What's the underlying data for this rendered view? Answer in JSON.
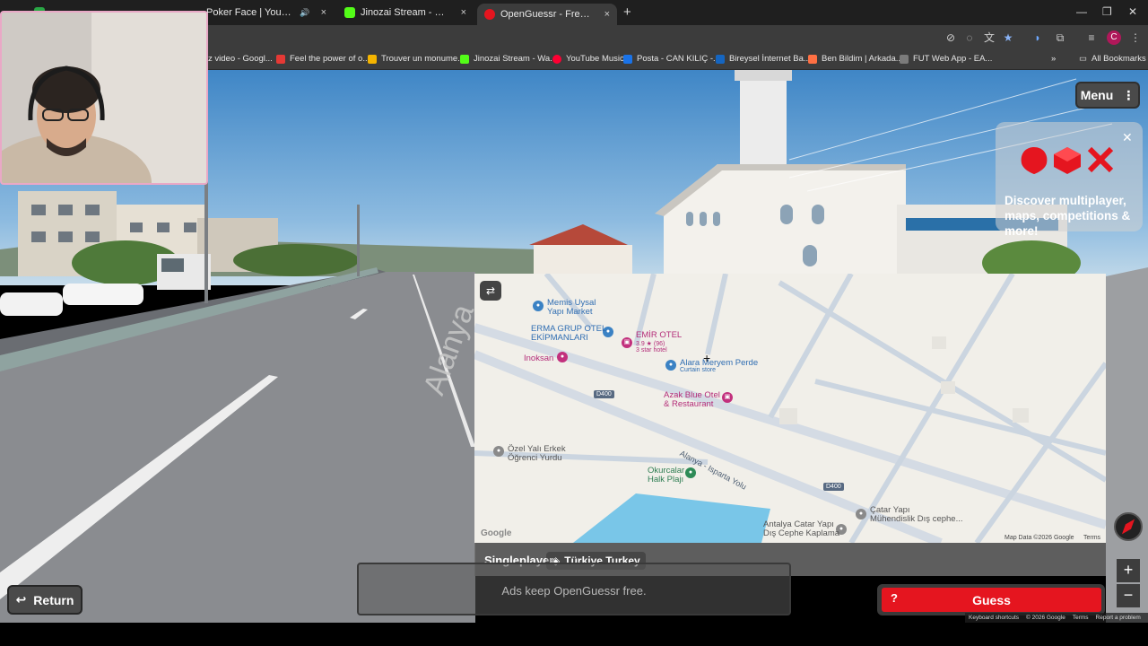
{
  "browser": {
    "tabs": [
      {
        "label": "",
        "favicon_color": "#29a745",
        "active": false
      },
      {
        "label": "Poker Face | YouTube Music",
        "favicon_color": "#ff0033",
        "active": false,
        "audio": "🔊"
      },
      {
        "label": "Jinozai Stream - Kick Dashboard",
        "favicon_color": "#53fc18",
        "active": false
      },
      {
        "label": "OpenGuessr - Free GeoGuessr A",
        "favicon_color": "#e5151f",
        "active": true
      }
    ],
    "new_tab": "+",
    "close": "×",
    "bookmarks": [
      {
        "label": "z video - Googl...",
        "favicon_color": "#4285f4"
      },
      {
        "label": "Feel the power of o...",
        "favicon_color": "#e53935"
      },
      {
        "label": "Trouver un monume...",
        "favicon_color": "#f4b400"
      },
      {
        "label": "Jinozai Stream - Wa...",
        "favicon_color": "#53fc18"
      },
      {
        "label": "YouTube Music",
        "favicon_color": "#ff0033"
      },
      {
        "label": "Posta - CAN KILIÇ -...",
        "favicon_color": "#1a73e8"
      },
      {
        "label": "Bireysel İnternet Ba...",
        "favicon_color": "#1565c0"
      },
      {
        "label": "Ben Bildim | Arkada...",
        "favicon_color": "#ff7043"
      },
      {
        "label": "FUT Web App - EA...",
        "favicon_color": "#7b7b7b"
      }
    ],
    "more_bookmarks": "»",
    "all_bookmarks": "All Bookmarks",
    "profile_initial": "C"
  },
  "game": {
    "menu_label": "Menu",
    "promo_text": "Discover multiplayer, maps, competitions & more!",
    "mode": "Singleplayer",
    "country": "Türkiye Turkey",
    "ad_text": "Ads keep OpenGuessr free.",
    "return_label": "Return",
    "guess_label": "Guess",
    "guess_help": "?",
    "zoom_in": "+",
    "zoom_out": "−"
  },
  "map": {
    "places": [
      {
        "name": "Memis Uysal",
        "sub": "Yapı Market",
        "color": "#3b82c4"
      },
      {
        "name": "ERMA GRUP OTEL",
        "sub": "EKİPMANLARI",
        "color": "#3b82c4"
      },
      {
        "name": "EMİR OTEL",
        "sub": "3.9 ★ (96)",
        "sub2": "3 star hotel",
        "color": "#c2307d"
      },
      {
        "name": "Inoksan",
        "color": "#c2307d"
      },
      {
        "name": "Alara Meryem Perde",
        "sub": "Curtain store",
        "color": "#3b82c4"
      },
      {
        "name": "Azak Blue Otel",
        "sub": "& Restaurant",
        "color": "#c2307d"
      },
      {
        "name": "Özel Yalı Erkek",
        "sub": "Öğrenci Yurdu",
        "color": "#6b6b6b"
      },
      {
        "name": "Okurcalar",
        "sub": "Halk Plajı",
        "color": "#2e8b57"
      },
      {
        "name": "Çatar Yapı",
        "sub": "Mühendislik Dış cephe...",
        "color": "#6b6b6b"
      },
      {
        "name": "Antalya Catar Yapı",
        "sub": "Dış Cephe Kaplama",
        "color": "#6b6b6b"
      }
    ],
    "roads": [
      "D400",
      "Alanya - Isparta Yolu",
      "D400"
    ],
    "attribution": "Map Data ©2026 Google",
    "terms": "Terms",
    "logo": "Google"
  },
  "footer": {
    "shortcuts": "Keyboard shortcuts",
    "copyright": "© 2026 Google",
    "terms": "Terms",
    "report": "Report a problem"
  }
}
